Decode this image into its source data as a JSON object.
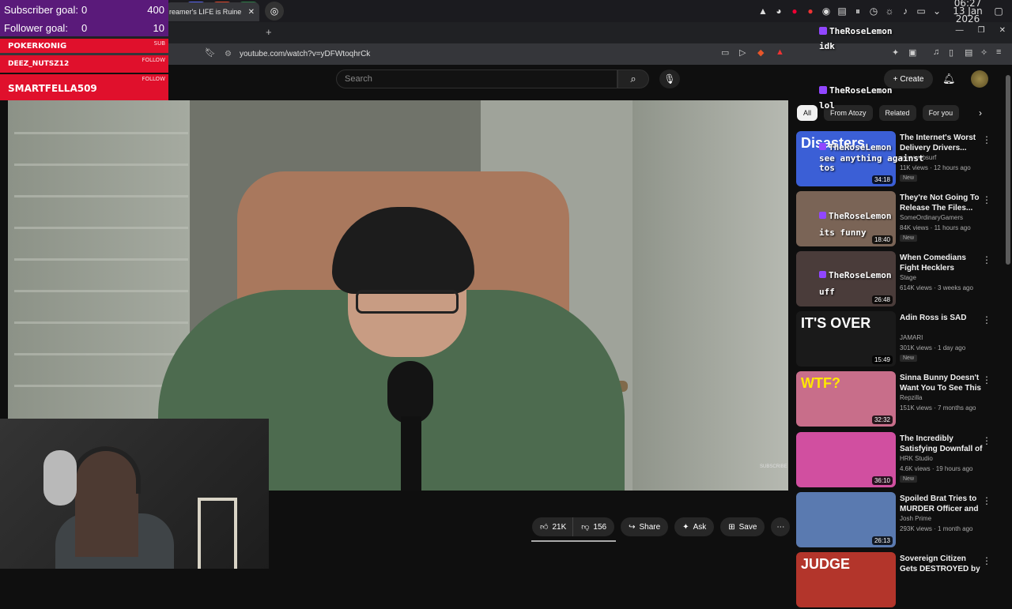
{
  "taskbar": {
    "clock_time": "06:27",
    "clock_date": "13 Jan 2026"
  },
  "browser": {
    "tab_title": "reamer's LIFE is Ruine",
    "url": "youtube.com/watch?v=yDFWtoqhrCk"
  },
  "youtube": {
    "search_placeholder": "Search",
    "create_label": "Create",
    "actions": {
      "likes": "21K",
      "dislikes": "156",
      "share": "Share",
      "ask": "Ask",
      "save": "Save"
    },
    "filters": [
      "All",
      "From Atozy",
      "Related",
      "For you"
    ],
    "recommendations": [
      {
        "title": "The Internet's Worst Delivery Drivers...",
        "channel": "wavywebsurf",
        "meta": "11K views · 12 hours ago",
        "badge": "New",
        "duration": "34:18",
        "thumb_color": "#3b5fd6",
        "thumb_text": "Disasters."
      },
      {
        "title": "They're Not Going To Release The Files...",
        "channel": "SomeOrdinaryGamers",
        "meta": "84K views · 11 hours ago",
        "badge": "New",
        "duration": "18:40",
        "thumb_color": "#7a6456",
        "thumb_text": ""
      },
      {
        "title": "When Comedians Fight Hecklers",
        "channel": "Stage",
        "meta": "614K views · 3 weeks ago",
        "badge": "",
        "duration": "26:48",
        "thumb_color": "#4a3c3a",
        "thumb_text": ""
      },
      {
        "title": "Adin Ross is SAD",
        "channel": "JAMARI",
        "meta": "301K views · 1 day ago",
        "badge": "New",
        "duration": "15:49",
        "thumb_color": "#1a1a1a",
        "thumb_text": "IT'S OVER"
      },
      {
        "title": "Sinna Bunny Doesn't Want You To See This ...",
        "channel": "Repzilla",
        "meta": "151K views · 7 months ago",
        "badge": "",
        "duration": "32:32",
        "thumb_color": "#c86e8a",
        "thumb_text": "WTF?"
      },
      {
        "title": "The Incredibly Satisfying Downfall of Belle ...",
        "channel": "HRK Studio",
        "meta": "4.6K views · 19 hours ago",
        "badge": "New",
        "duration": "36:10",
        "thumb_color": "#d14fa0",
        "thumb_text": ""
      },
      {
        "title": "Spoiled Brat Tries to MURDER Officer and ...",
        "channel": "Josh Prime",
        "meta": "293K views · 1 month ago",
        "badge": "",
        "duration": "26:13",
        "thumb_color": "#5a7ab0",
        "thumb_text": ""
      },
      {
        "title": "Sovereign Citizen Gets DESTROYED by Judge",
        "channel": "",
        "meta": "",
        "badge": "",
        "duration": "",
        "thumb_color": "#b3352b",
        "thumb_text": "JUDGE"
      }
    ]
  },
  "video": {
    "subscribe_watermark": "SUBSCRIBE"
  },
  "stream_overlay": {
    "subscriber_goal_label": "Subscriber goal:",
    "subscriber_goal_current": "0",
    "subscriber_goal_target": "400",
    "follower_goal_label": "Follower goal:",
    "follower_goal_current": "0",
    "follower_goal_target": "10",
    "alerts": [
      {
        "name": "POKERKONIG",
        "type": "SUB"
      },
      {
        "name": "DEEZ_NUTSZ12",
        "type": "FOLLOW"
      },
      {
        "name": "SMARTFELLA509",
        "type": "FOLLOW"
      }
    ],
    "chat": [
      {
        "user": "TheRoseLemon",
        "message": "idk"
      },
      {
        "user": "TheRoseLemon",
        "message": "lol"
      }
    ],
    "thumb_chat": [
      {
        "user": "TheRoseLemon",
        "message": "see anything against tos"
      },
      {
        "user": "TheRoseLemon",
        "message": "its funny"
      },
      {
        "user": "TheRoseLemon",
        "message": "uff"
      }
    ]
  }
}
